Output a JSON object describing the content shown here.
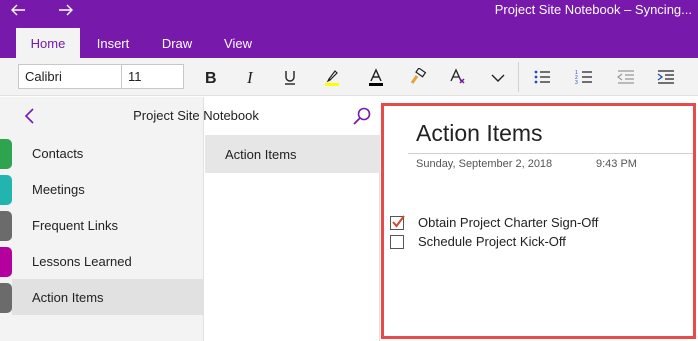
{
  "window": {
    "title": "Project Site Notebook – Syncing..."
  },
  "ribbon": {
    "tabs": [
      {
        "label": "Home",
        "active": true
      },
      {
        "label": "Insert",
        "active": false
      },
      {
        "label": "Draw",
        "active": false
      },
      {
        "label": "View",
        "active": false
      }
    ]
  },
  "toolbar": {
    "font_name": "Calibri",
    "font_size": "11",
    "buttons": [
      "bold-icon",
      "italic-icon",
      "underline-icon",
      "highlight-icon",
      "font-color-icon",
      "format-painter-icon",
      "clear-formatting-icon",
      "chevron-down-icon",
      "bullets-icon",
      "numbering-icon",
      "decrease-indent-icon",
      "increase-indent-icon"
    ],
    "highlight_color": "#ffff00",
    "font_color": "#000000"
  },
  "notebook": {
    "title": "Project Site Notebook"
  },
  "sections": [
    {
      "label": "Contacts",
      "color": "#2ea44f"
    },
    {
      "label": "Meetings",
      "color": "#22b5b0"
    },
    {
      "label": "Frequent Links",
      "color": "#6b6b6b"
    },
    {
      "label": "Lessons Learned",
      "color": "#b4009e"
    },
    {
      "label": "Action Items",
      "color": "#6b6b6b",
      "active": true
    }
  ],
  "pages": [
    {
      "label": "Action Items",
      "active": true
    }
  ],
  "page": {
    "title": "Action Items",
    "date": "Sunday, September 2, 2018",
    "time": "9:43 PM",
    "todos": [
      {
        "label": "Obtain Project Charter Sign-Off",
        "checked": true
      },
      {
        "label": "Schedule Project Kick-Off",
        "checked": false
      }
    ]
  },
  "colors": {
    "accent": "#7719aa",
    "highlight_border": "#e84a4a",
    "check": "#d04a2e"
  }
}
